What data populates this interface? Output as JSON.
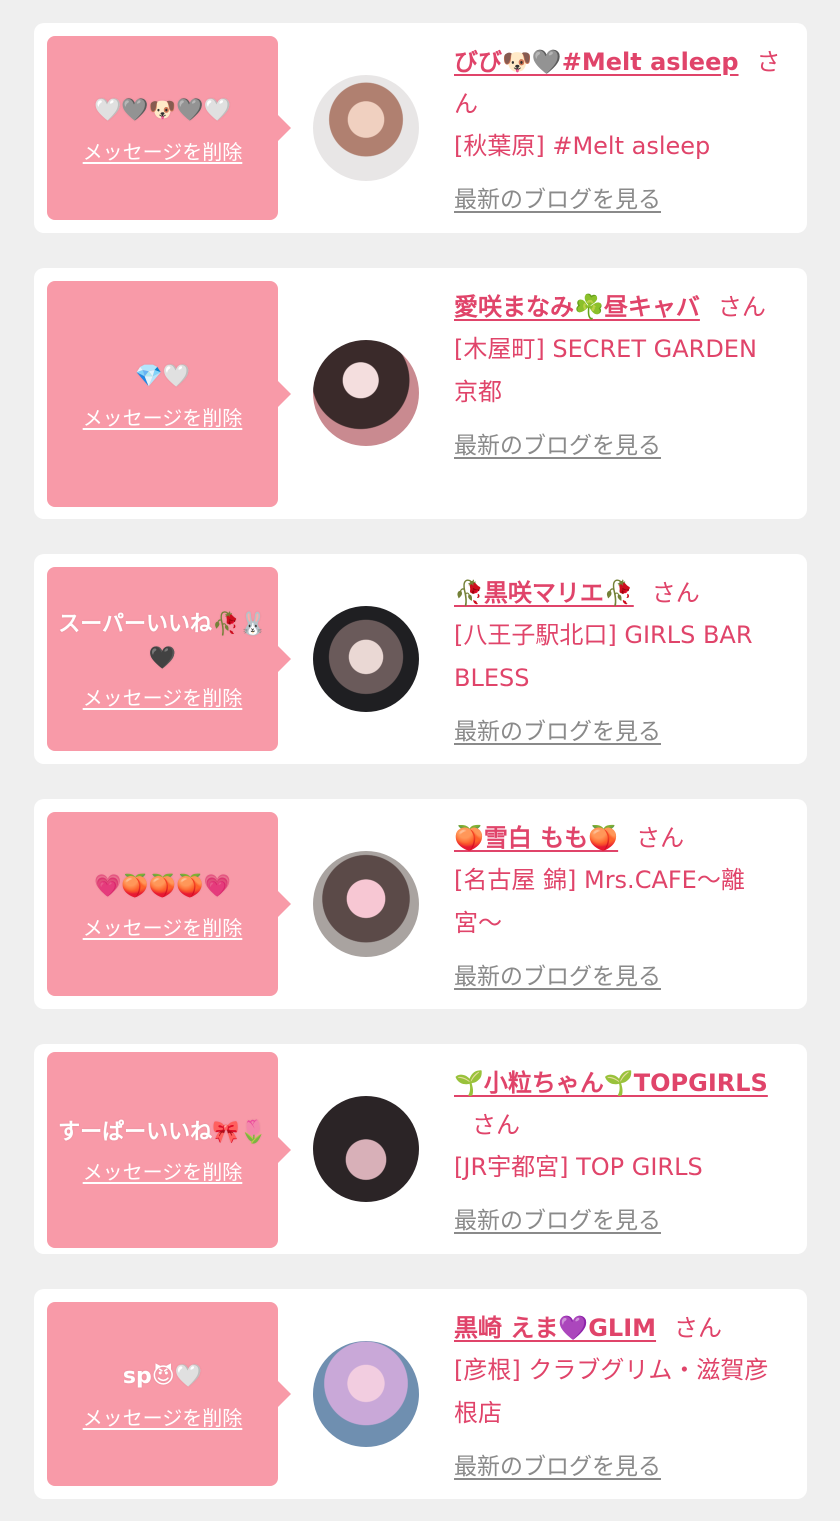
{
  "items": [
    {
      "message": "🤍🩶🐶🩶🤍",
      "delete_label": "メッセージを削除",
      "name": "びび🐶🩶#Melt asleep",
      "honorific": "さん",
      "shop": "[秋葉原] #Melt asleep",
      "blog_label": "最新のブログを見る"
    },
    {
      "message": "💎🤍",
      "delete_label": "メッセージを削除",
      "name": "愛咲まなみ☘️昼キャバ",
      "honorific": "さん",
      "shop": "[木屋町] SECRET GARDEN 京都",
      "blog_label": "最新のブログを見る"
    },
    {
      "message": "スーパーいいね🥀🐰🖤",
      "delete_label": "メッセージを削除",
      "name": "🥀黒咲マリエ🥀",
      "honorific": "さん",
      "shop": "[八王子駅北口] GIRLS BAR BLESS",
      "blog_label": "最新のブログを見る"
    },
    {
      "message": "💗🍑🍑🍑💗",
      "delete_label": "メッセージを削除",
      "name": "🍑雪白 もも🍑",
      "honorific": "さん",
      "shop": "[名古屋 錦] Mrs.CAFE〜離宮〜",
      "blog_label": "最新のブログを見る"
    },
    {
      "message": "すーぱーいいね🎀🌷",
      "delete_label": "メッセージを削除",
      "name": "🌱小粒ちゃん🌱TOPGIRLS",
      "honorific": "さん",
      "shop": "[JR宇都宮] TOP GIRLS",
      "blog_label": "最新のブログを見る"
    },
    {
      "message": "sp😈🤍",
      "delete_label": "メッセージを削除",
      "name": "黒崎 えま💜GLIM",
      "honorific": "さん",
      "shop": "[彦根] クラブグリム・滋賀彦根店",
      "blog_label": "最新のブログを見る"
    }
  ]
}
